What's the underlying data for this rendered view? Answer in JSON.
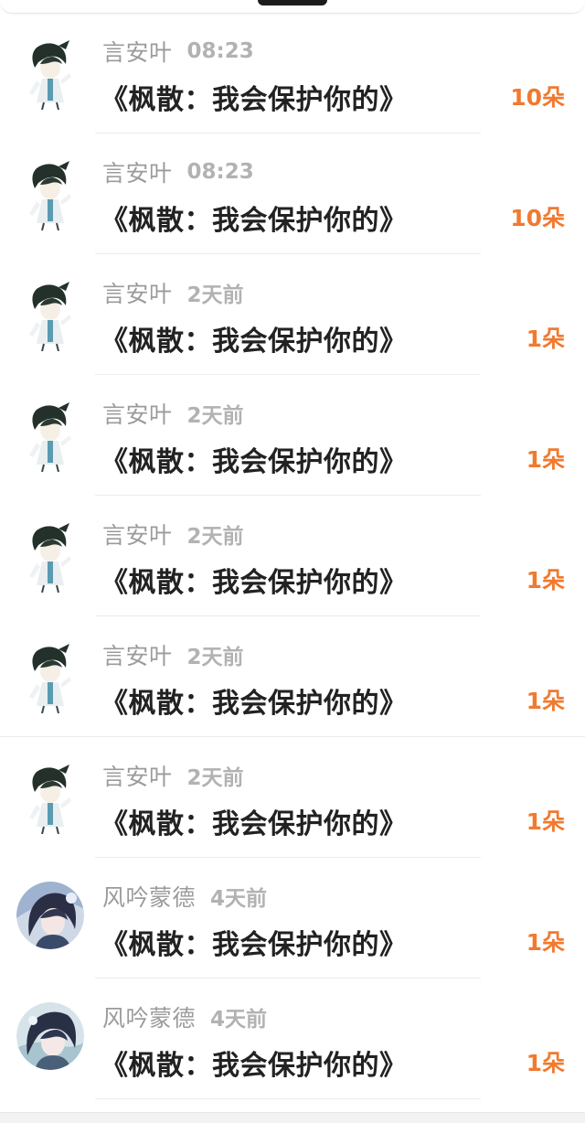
{
  "list": {
    "items": [
      {
        "name": "言安叶",
        "time": "08:23",
        "title": "《枫散：我会保护你的》",
        "amount": "10朵",
        "avatar": "character-avatar-icon"
      },
      {
        "name": "言安叶",
        "time": "08:23",
        "title": "《枫散：我会保护你的》",
        "amount": "10朵",
        "avatar": "character-avatar-icon"
      },
      {
        "name": "言安叶",
        "time": "2天前",
        "title": "《枫散：我会保护你的》",
        "amount": "1朵",
        "avatar": "character-avatar-icon"
      },
      {
        "name": "言安叶",
        "time": "2天前",
        "title": "《枫散：我会保护你的》",
        "amount": "1朵",
        "avatar": "character-avatar-icon"
      },
      {
        "name": "言安叶",
        "time": "2天前",
        "title": "《枫散：我会保护你的》",
        "amount": "1朵",
        "avatar": "character-avatar-icon"
      },
      {
        "name": "言安叶",
        "time": "2天前",
        "title": "《枫散：我会保护你的》",
        "amount": "1朵",
        "avatar": "character-avatar-icon"
      },
      {
        "name": "言安叶",
        "time": "2天前",
        "title": "《枫散：我会保护你的》",
        "amount": "1朵",
        "avatar": "character-avatar-icon"
      },
      {
        "name": "风吟蒙德",
        "time": "4天前",
        "title": "《枫散：我会保护你的》",
        "amount": "1朵",
        "avatar": "round-avatar-icon"
      },
      {
        "name": "风吟蒙德",
        "time": "4天前",
        "title": "《枫散：我会保护你的》",
        "amount": "1朵",
        "avatar": "round-avatar-icon"
      }
    ]
  },
  "colors": {
    "amount": "#f07a2f",
    "name": "#9b9b9b",
    "title": "#222222"
  }
}
